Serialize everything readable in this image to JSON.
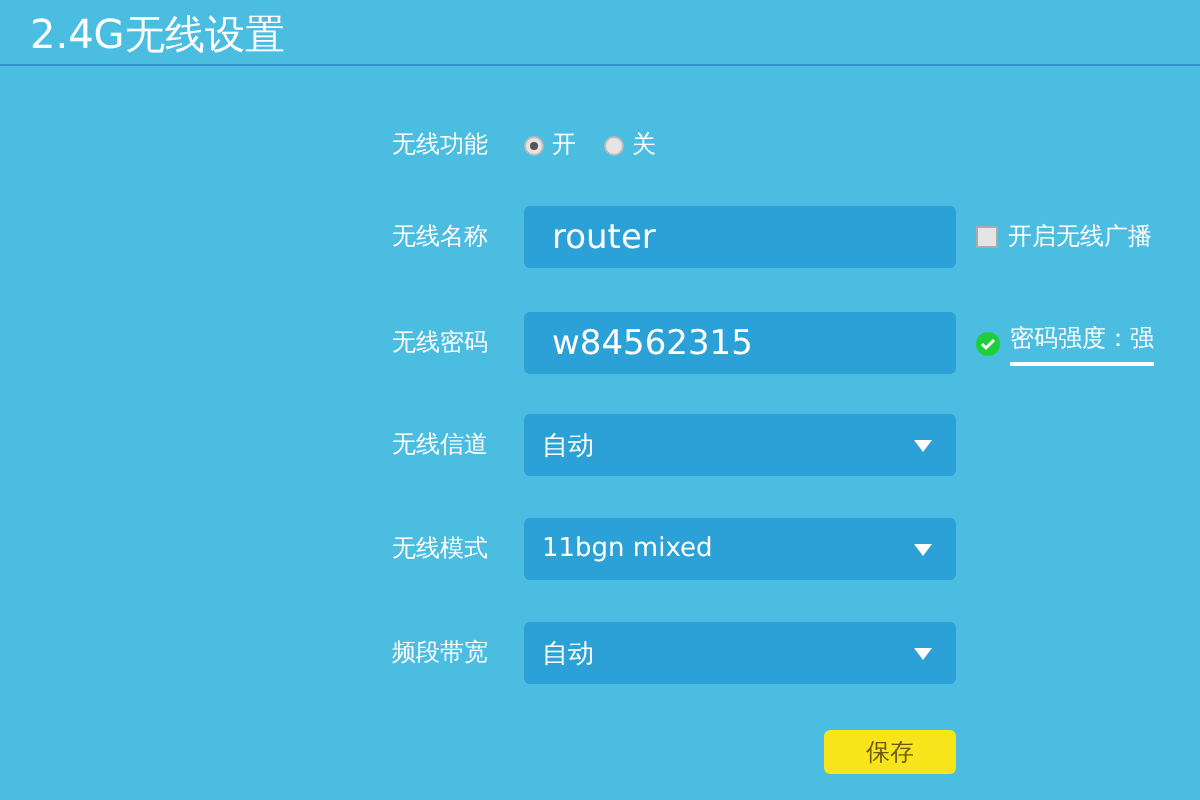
{
  "title": "2.4G无线设置",
  "rows": [
    {
      "kind": "radio",
      "label": "无线功能",
      "options": [
        {
          "label": "开",
          "selected": true
        },
        {
          "label": "关",
          "selected": false
        }
      ]
    },
    {
      "kind": "text",
      "label": "无线名称",
      "value": "router",
      "extra": {
        "kind": "checkbox",
        "label": "开启无线广播",
        "checked": false
      }
    },
    {
      "kind": "text",
      "label": "无线密码",
      "value": "w84562315",
      "extra": {
        "kind": "strength",
        "label": "密码强度：强"
      }
    },
    {
      "kind": "select",
      "label": "无线信道",
      "value": "自动"
    },
    {
      "kind": "select",
      "label": "无线模式",
      "value": "11bgn mixed"
    },
    {
      "kind": "select",
      "label": "频段带宽",
      "value": "自动"
    }
  ],
  "save_button": "保存"
}
